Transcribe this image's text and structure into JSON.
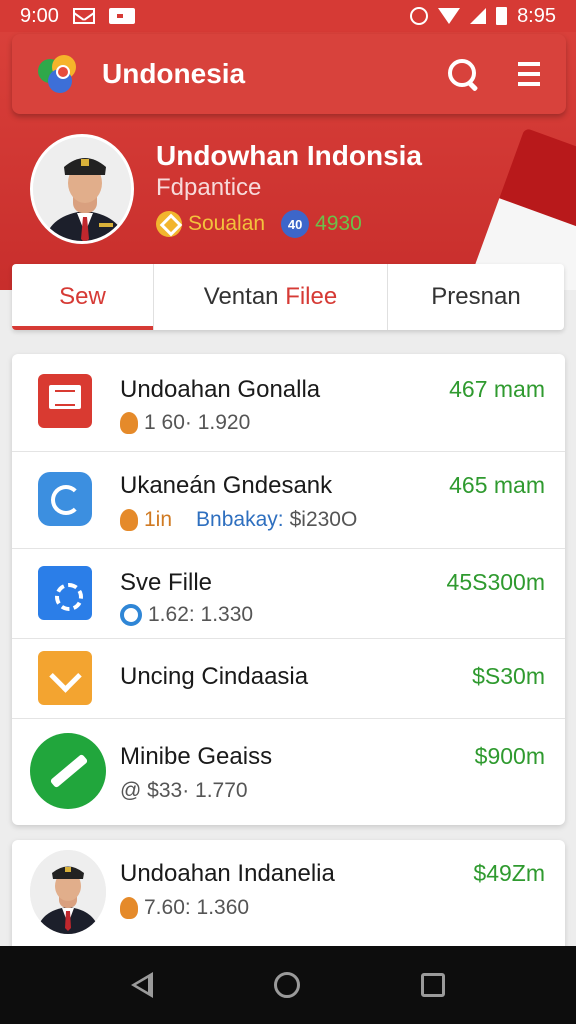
{
  "status_bar": {
    "time": "9:00",
    "clock_right": "8:95",
    "icons": [
      "mail-icon",
      "card-icon",
      "alarm-icon",
      "wifi-icon",
      "signal-icon",
      "battery-icon"
    ]
  },
  "app_bar": {
    "title": "Undonesia",
    "icons": [
      "app-logo-icon",
      "search-icon",
      "menu-icon"
    ]
  },
  "profile": {
    "name": "Undowhan Indonsia",
    "subtitle": "Fdpantice",
    "badge_gold_label": "Soualan",
    "badge_blue_label": "4930"
  },
  "tabs": [
    {
      "label": "Sew",
      "active": true
    },
    {
      "label_pre": "Ventan ",
      "label_hl": "File",
      "label_post": "e",
      "active": false
    },
    {
      "label": "Presnan",
      "active": false
    }
  ],
  "list": [
    {
      "title": "Undoahan Gonalla",
      "meta": "1 60· 1.920",
      "amount": "467 mam",
      "icon": "document-icon"
    },
    {
      "title": "Ukaneán Gndesank",
      "meta": "1in",
      "meta_extra": "Bnbakay:",
      "meta_extra2": "$i230O",
      "amount": "465 mam",
      "icon": "sync-icon"
    },
    {
      "title": "Sve Fille",
      "meta": "1.62: 1.330",
      "amount": "45S300m",
      "icon": "gear-icon"
    },
    {
      "title": "Uncing Cindaasia",
      "meta": "",
      "amount": "$S30m",
      "icon": "folder-download-icon"
    },
    {
      "title": "Minibe Geaiss",
      "meta": "@ $33· 1.770",
      "amount": "$900m",
      "icon": "pen-icon"
    }
  ],
  "bottom_item": {
    "title": "Undoahan Indanelia",
    "meta": "7.60: 1.360",
    "amount": "$49Zm"
  },
  "colors": {
    "brand_red": "#d63a35",
    "amount_green": "#2f9a2f",
    "accent_blue": "#2e6fbf"
  }
}
